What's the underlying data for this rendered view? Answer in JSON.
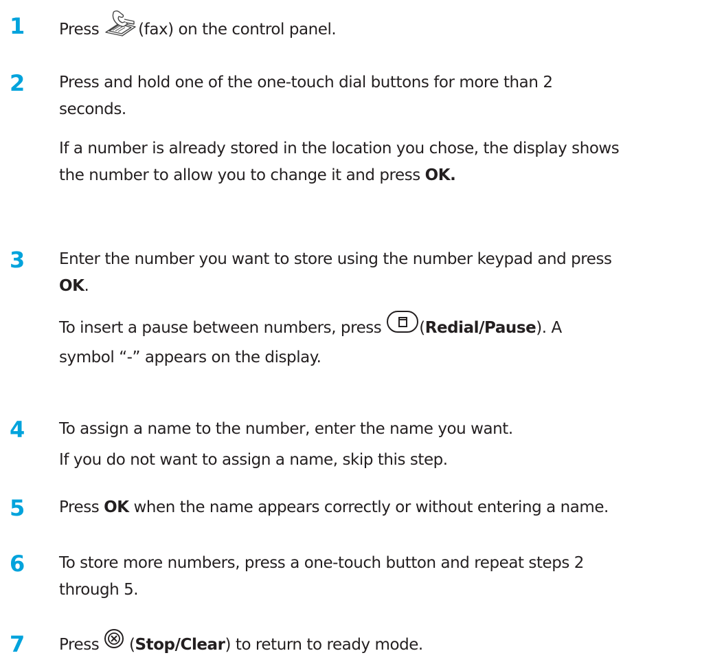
{
  "steps": [
    {
      "number": "1",
      "lines": [
        {
          "pre": "Press ",
          "icon": "fax-icon",
          "post": "(fax) on the control panel."
        }
      ]
    },
    {
      "number": "2",
      "para1": [
        "Press and hold one of the one-touch dial buttons for more than 2",
        "seconds."
      ],
      "para2_line1": "If a number is already stored in the location you chose, the display shows",
      "para2_line2_text": "the number to allow you to change it and press ",
      "para2_line2_bold": "OK."
    },
    {
      "number": "3",
      "para1_line1": "Enter the number you want to store using the number keypad and press",
      "para1_line2_bold": "OK",
      "para1_line2_tail": ".",
      "para2_line1_pre": "To insert a pause between numbers, press ",
      "para2_line1_open": "(",
      "para2_line1_bold": "Redial/Pause",
      "para2_line1_post": "). A",
      "para2_line2": "symbol “-” appears on the display."
    },
    {
      "number": "4",
      "line1": "To assign a name to the number, enter the name you want.",
      "line2": "If you do not want to assign a name, skip this step."
    },
    {
      "number": "5",
      "pre": "Press ",
      "bold": "OK",
      "post": " when the name appears correctly or without entering a name."
    },
    {
      "number": "6",
      "line1": "To store more numbers, press a one-touch button and repeat steps 2",
      "line2": "through 5."
    },
    {
      "number": "7",
      "pre": "Press ",
      "open": " (",
      "bold": "Stop/Clear",
      "post": ") to return to ready mode."
    }
  ],
  "colors": {
    "step_number": "#00a3dc",
    "text": "#231f20"
  },
  "icons": [
    "fax-icon",
    "redial-pause-icon",
    "stop-clear-icon"
  ]
}
